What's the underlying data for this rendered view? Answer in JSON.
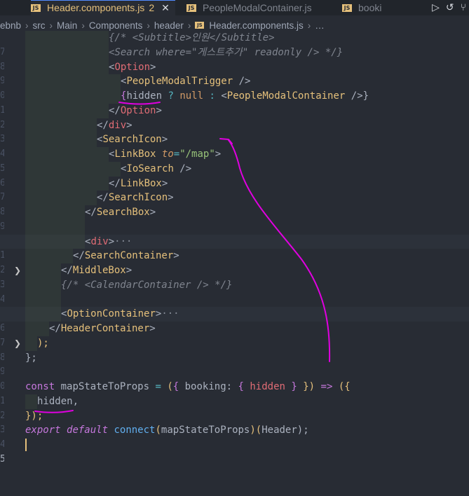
{
  "tabs": [
    {
      "label": "Header.components.js",
      "badge": "2",
      "close": "✕",
      "state": "active"
    },
    {
      "label": "PeopleModalContainer.js",
      "state": "inactive"
    },
    {
      "label": "booki",
      "state": "inactive"
    }
  ],
  "tab_icons": [
    "play-icon",
    "history-icon",
    "git-compare-icon"
  ],
  "breadcrumb": [
    "ebnb",
    "src",
    "Main",
    "Components",
    "header",
    "Header.components.js",
    "…"
  ],
  "gutter": [
    "7",
    "8",
    "9",
    "0",
    "1",
    "2",
    "3",
    "4",
    "5",
    "6",
    "7",
    "8",
    "9",
    "0",
    "1",
    "2",
    "3",
    "4",
    "5",
    "6",
    "7",
    "8",
    "9",
    "0",
    "1",
    "2",
    "3",
    "4",
    "5",
    "6",
    "7"
  ],
  "code": {
    "l0": {
      "a": "{/* ",
      "b": "<Subtitle>",
      "c": "인원",
      "d": "</Subtitle>"
    },
    "l1": {
      "a": "<Search where=\"게스트추가\" readonly /> */}"
    },
    "l2": {
      "a": "<",
      "b": "Option",
      "c": ">"
    },
    "l3": {
      "a": "<",
      "b": "PeopleModalTrigger",
      "c": " />"
    },
    "l4": {
      "a": "{",
      "b": "hidden",
      "c": " ? ",
      "d": "null",
      "e": " : ",
      "f": "<",
      "g": "PeopleModalContainer",
      "h": " />}"
    },
    "l5": {
      "a": "</",
      "b": "Option",
      "c": ">"
    },
    "l6": {
      "a": "</",
      "b": "div",
      "c": ">"
    },
    "l7": {
      "a": "<",
      "b": "SearchIcon",
      "c": ">"
    },
    "l8": {
      "a": "<",
      "b": "LinkBox",
      "c": " ",
      "d": "to",
      "e": "=",
      "f": "\"/map\"",
      "g": ">"
    },
    "l9": {
      "a": "<",
      "b": "IoSearch",
      "c": " />"
    },
    "l10": {
      "a": "</",
      "b": "LinkBox",
      "c": ">"
    },
    "l11": {
      "a": "</",
      "b": "SearchIcon",
      "c": ">"
    },
    "l12": {
      "a": "</",
      "b": "SearchBox",
      "c": ">"
    },
    "l14": {
      "a": "<",
      "b": "div",
      "c": ">",
      "d": "···"
    },
    "l15": {
      "a": "</",
      "b": "SearchContainer",
      "c": ">"
    },
    "l16": {
      "a": "</",
      "b": "MiddleBox",
      "c": ">"
    },
    "l17": {
      "a": "{/* <CalendarContainer /> */}"
    },
    "l19": {
      "a": "<",
      "b": "OptionContainer",
      "c": ">",
      "d": "···"
    },
    "l20": {
      "a": "</",
      "b": "HeaderContainer",
      "c": ">"
    },
    "l21": {
      "a": ");"
    },
    "l22": {
      "a": "};"
    },
    "l24": {
      "a": "const",
      "b": " ",
      "c": "mapStateToProps",
      "d": " = ",
      "e": "(",
      "f": "{ ",
      "g": "booking",
      "h": ": ",
      "i": "{ ",
      "j": "hidden",
      "k": " }",
      "l": " })",
      "m": " => ",
      "n": "({"
    },
    "l25": {
      "a": "hidden",
      "b": ","
    },
    "l26": {
      "a": "});"
    },
    "l27": {
      "a": "export",
      "b": " ",
      "c": "default",
      "d": " ",
      "e": "connect",
      "f": "(",
      "g": "mapStateToProps",
      "h": ")(",
      "i": "Header",
      "j": ");"
    }
  },
  "colors": {
    "background": "#282c34",
    "annotation": "#e000e0",
    "accent": "#e5c07b"
  }
}
